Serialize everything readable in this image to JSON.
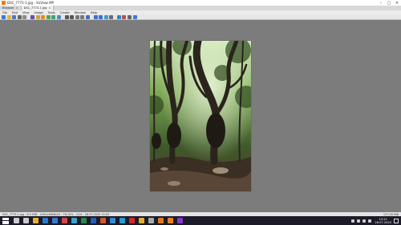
{
  "window": {
    "title": "DSC_7773-1.jpg - XnView MP",
    "controls": [
      "minimize-icon",
      "maximize-icon",
      "close-icon"
    ]
  },
  "tabs": [
    {
      "label": "Browser",
      "active": false
    },
    {
      "label": "DSC_7773-1.jpg",
      "active": true
    }
  ],
  "menu": [
    "File",
    "Edit",
    "View",
    "Image",
    "Tools",
    "Create",
    "Window",
    "Help"
  ],
  "toolbar": {
    "icons": [
      {
        "name": "home-icon",
        "color": "#3b7bd1"
      },
      {
        "name": "folder-icon",
        "color": "#e6b43c"
      },
      {
        "name": "save-icon",
        "color": "#4a78c2"
      },
      {
        "name": "print-icon",
        "color": "#666666"
      },
      {
        "name": "copy-icon",
        "color": "#8a8a8a"
      },
      {
        "name": "crop-icon",
        "color": "#6a4aa8"
      },
      {
        "name": "rotate-icon",
        "color": "#c9a63b"
      },
      {
        "name": "adjust-icon",
        "color": "#e28a2a"
      },
      {
        "name": "filter-icon",
        "color": "#4aa84e"
      },
      {
        "name": "effects-icon",
        "color": "#3fa07a"
      },
      {
        "name": "resize-icon",
        "color": "#4a90c2"
      },
      {
        "name": "zoom-in-icon",
        "color": "#555555"
      },
      {
        "name": "zoom-out-icon",
        "color": "#555555"
      },
      {
        "name": "fit-icon",
        "color": "#777777"
      },
      {
        "name": "actual-size-icon",
        "color": "#777777"
      },
      {
        "name": "fullscreen-icon",
        "color": "#4a6fb5"
      },
      {
        "name": "prev-icon",
        "color": "#3f6fc9"
      },
      {
        "name": "next-icon",
        "color": "#3f6fc9"
      },
      {
        "name": "slideshow-icon",
        "color": "#3f9bd1"
      },
      {
        "name": "compare-icon",
        "color": "#6b6b6b"
      },
      {
        "name": "info-icon",
        "color": "#2a8ad1"
      },
      {
        "name": "histogram-icon",
        "color": "#c24a4a"
      },
      {
        "name": "settings-icon",
        "color": "#666666"
      },
      {
        "name": "help-icon",
        "color": "#3f7ad1"
      }
    ]
  },
  "image": {
    "alt": "Forest trees photo"
  },
  "status": {
    "left": "DSC_7773-1.jpg - 8.5 MiB - 2592x3888x24 - 76,10% - 1/14 - 26.07.2020 15:20",
    "right": "127,08 MiB"
  },
  "taskbar": {
    "apps": [
      {
        "name": "search-icon",
        "color": "#cccccc"
      },
      {
        "name": "task-view-icon",
        "color": "#cccccc"
      },
      {
        "name": "file-explorer-icon",
        "color": "#e6b43c"
      },
      {
        "name": "mail-icon",
        "color": "#2b7ad1"
      },
      {
        "name": "store-icon",
        "color": "#3a7ad1"
      },
      {
        "name": "calendar-icon",
        "color": "#d14a4a"
      },
      {
        "name": "photos-icon",
        "color": "#3fa0c9"
      },
      {
        "name": "excel-icon",
        "color": "#2a8a4e"
      },
      {
        "name": "word-icon",
        "color": "#2b5bb5"
      },
      {
        "name": "powerpoint-icon",
        "color": "#d05a2a"
      },
      {
        "name": "onedrive-icon",
        "color": "#3a8ad1"
      },
      {
        "name": "edge-icon",
        "color": "#2a9ad1"
      },
      {
        "name": "opera-icon",
        "color": "#d12a2a"
      },
      {
        "name": "chrome-icon",
        "color": "#e0b02a"
      },
      {
        "name": "settings-icon",
        "color": "#aaaaaa"
      },
      {
        "name": "firefox-icon",
        "color": "#e07a1c"
      },
      {
        "name": "xnview-icon",
        "color": "#e8831c"
      },
      {
        "name": "onenote-icon",
        "color": "#8a3ac9"
      }
    ],
    "clock_time": "15:21",
    "clock_date": "26.07.2020"
  }
}
